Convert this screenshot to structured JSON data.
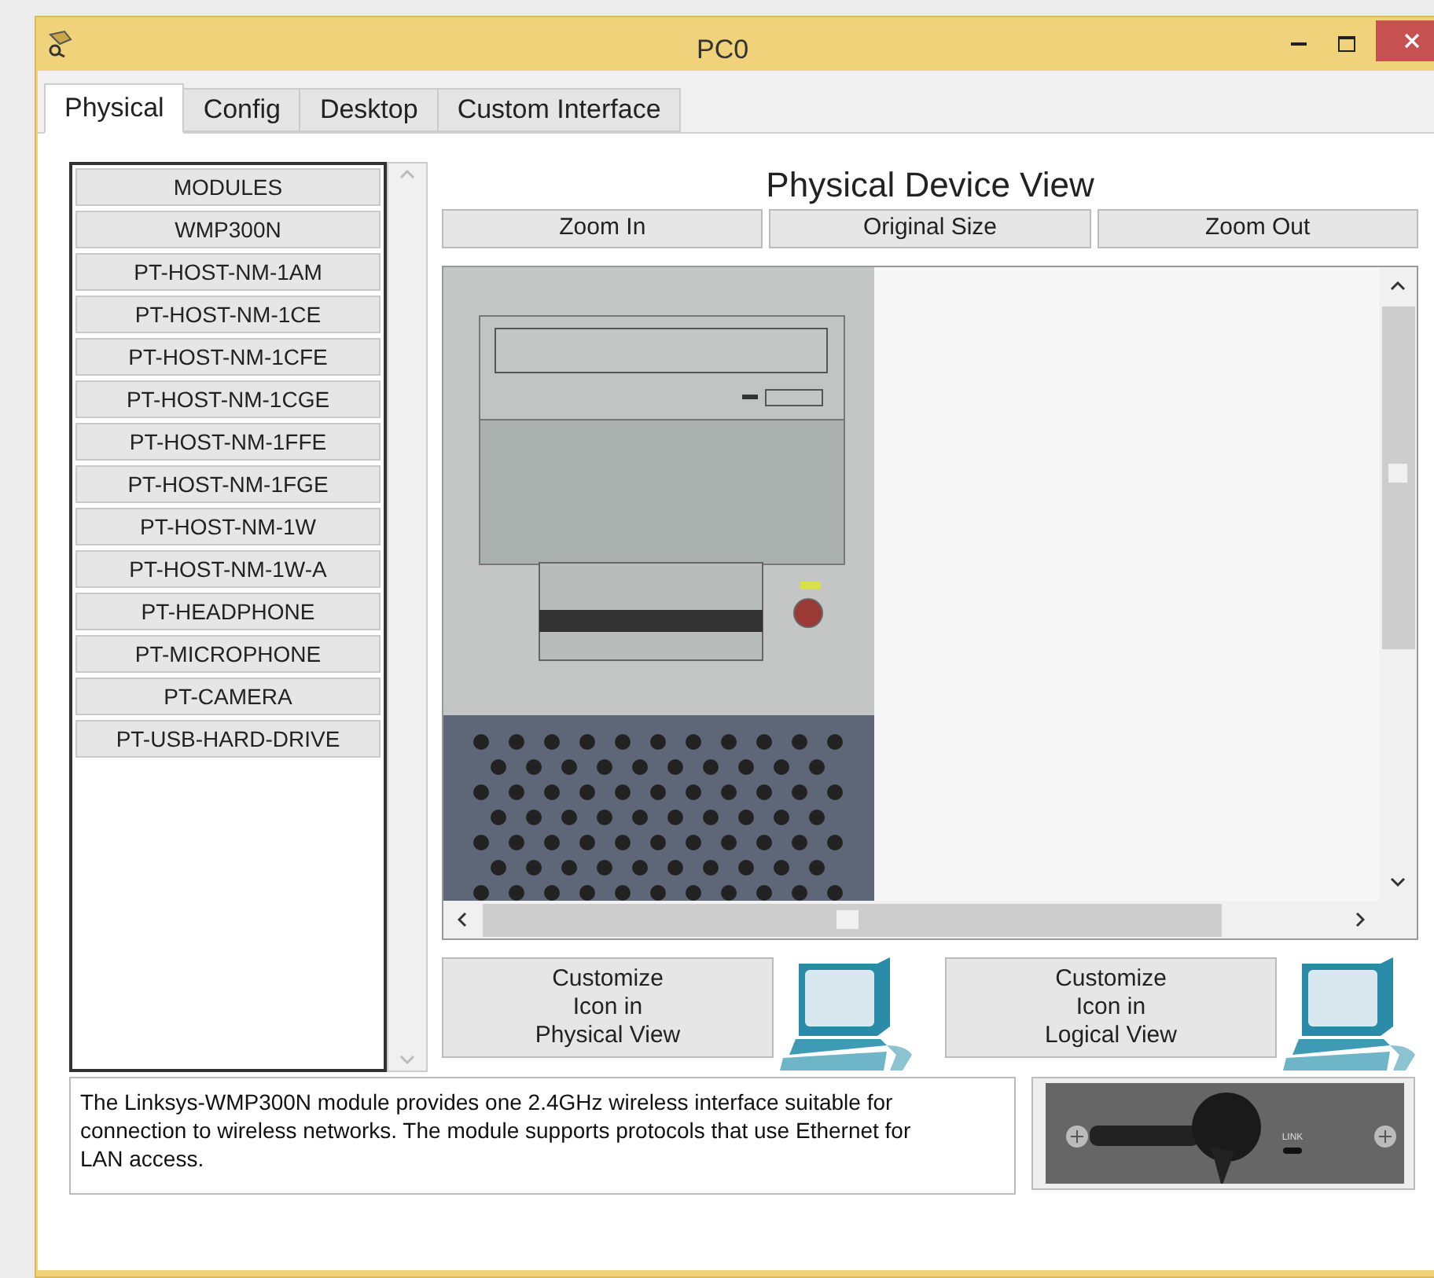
{
  "window": {
    "title": "PC0"
  },
  "tabs": [
    {
      "label": "Physical",
      "selected": true
    },
    {
      "label": "Config",
      "selected": false
    },
    {
      "label": "Desktop",
      "selected": false
    },
    {
      "label": "Custom Interface",
      "selected": false
    }
  ],
  "modules": [
    "MODULES",
    "WMP300N",
    "PT-HOST-NM-1AM",
    "PT-HOST-NM-1CE",
    "PT-HOST-NM-1CFE",
    "PT-HOST-NM-1CGE",
    "PT-HOST-NM-1FFE",
    "PT-HOST-NM-1FGE",
    "PT-HOST-NM-1W",
    "PT-HOST-NM-1W-A",
    "PT-HEADPHONE",
    "PT-MICROPHONE",
    "PT-CAMERA",
    "PT-USB-HARD-DRIVE"
  ],
  "view_title": "Physical Device View",
  "zoom_buttons": [
    "Zoom In",
    "Original Size",
    "Zoom Out"
  ],
  "customize_buttons": [
    "Customize\nIcon in\nPhysical View",
    "Customize\nIcon in\nLogical View"
  ],
  "description": "The Linksys-WMP300N module provides one 2.4GHz wireless interface suitable for connection to wireless networks. The module supports protocols that use Ethernet for LAN access.",
  "module_image_label": "LINK"
}
